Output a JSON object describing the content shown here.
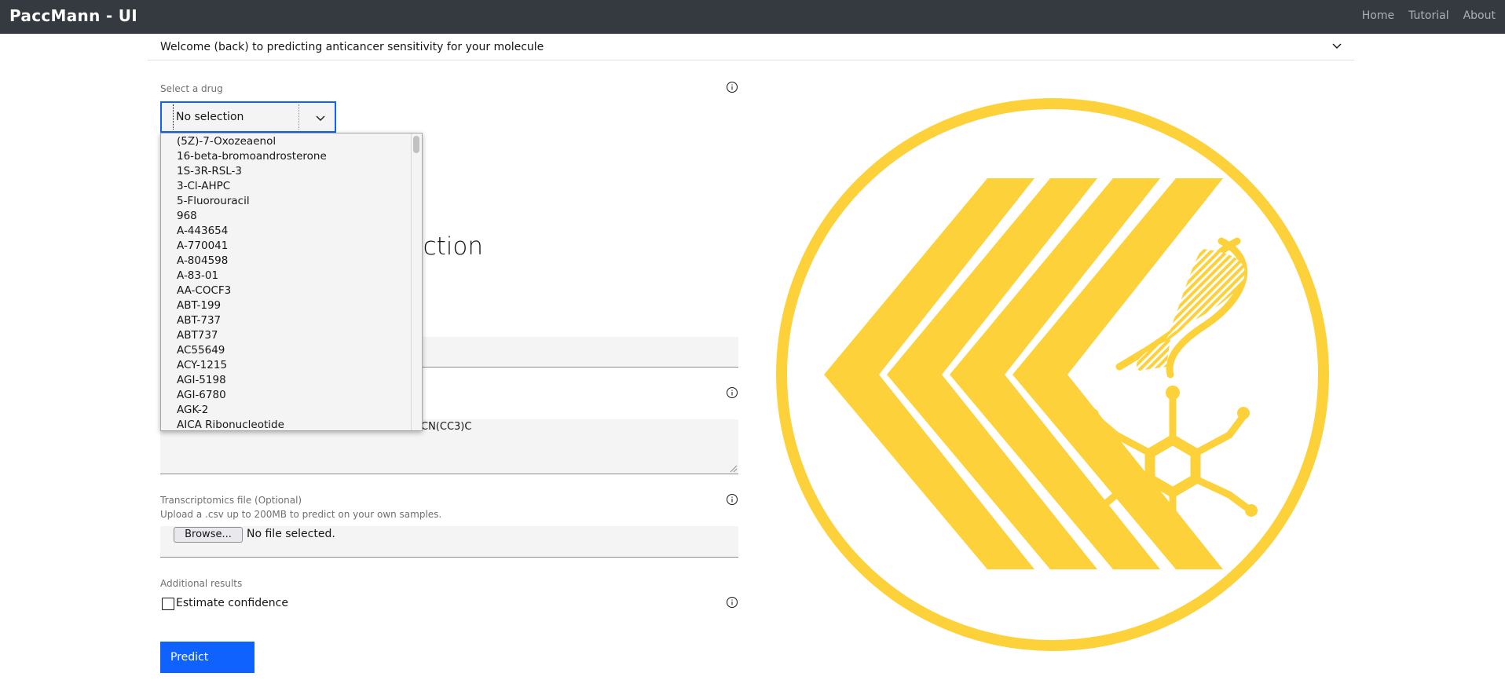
{
  "app": {
    "title": "PaccMann - UI"
  },
  "nav": {
    "links": [
      "Home",
      "Tutorial",
      "About"
    ]
  },
  "accordion": {
    "title": "Welcome (back) to predicting anticancer sensitivity for your molecule"
  },
  "drug_select": {
    "label": "Select a drug",
    "value": "No selection",
    "options": [
      "(5Z)-7-Oxozeaenol",
      "16-beta-bromoandrosterone",
      "1S-3R-RSL-3",
      "3-Cl-AHPC",
      "5-Fluorouracil",
      "968",
      "A-443654",
      "A-770041",
      "A-804598",
      "A-83-01",
      "AA-COCF3",
      "ABT-199",
      "ABT-737",
      "ABT737",
      "AC55649",
      "ACY-1215",
      "AGI-5198",
      "AGI-6780",
      "AGK-2",
      "AICA Ribonucleotide"
    ]
  },
  "main": {
    "heading_fragment": "iction"
  },
  "smiles": {
    "visible_value": "CN(CC3)C"
  },
  "transcriptomics": {
    "label": "Transcriptomics file (Optional)",
    "helper": "Upload a .csv up to 200MB to predict on your own samples.",
    "browse_label": "Browse...",
    "status": "No file selected."
  },
  "additional": {
    "label": "Additional results",
    "confidence_label": "Estimate confidence"
  },
  "predict": {
    "label": "Predict"
  },
  "icons": [
    "chevron-down-icon",
    "info-icon",
    "paccmann-logo"
  ],
  "colors": {
    "navbar": "#343a40",
    "primary": "#0f62fe",
    "logo_yellow": "#fdd13a",
    "field_bg": "#f4f4f4"
  }
}
